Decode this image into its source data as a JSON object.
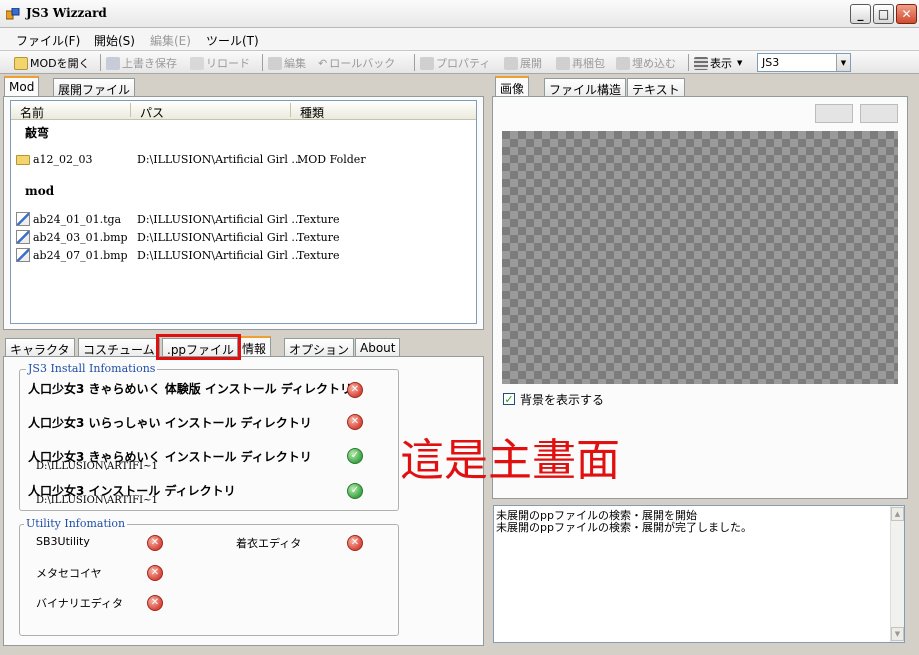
{
  "window": {
    "title": "JS3 Wizzard"
  },
  "menu": {
    "file": "ファイル(F)",
    "start": "開始(S)",
    "edit": "編集(E)",
    "tools": "ツール(T)"
  },
  "toolbar": {
    "open_mod": "MODを開く",
    "overwrite_save": "上書き保存",
    "reload": "リロード",
    "edit": "編集",
    "rollback": "ロールバック",
    "properties": "プロパティ",
    "expand": "展開",
    "repack": "再梱包",
    "embed": "埋め込む",
    "view": "表示",
    "game_select": "JS3"
  },
  "left_tabs": [
    "Mod",
    "展開ファイル"
  ],
  "mod_list": {
    "columns": [
      "名前",
      "パス",
      "種類"
    ],
    "groups": [
      {
        "name": "敲弯",
        "rows": [
          {
            "name": "a12_02_03",
            "path": "D:\\ILLUSION\\Artificial Girl ...",
            "type": "MOD Folder"
          }
        ]
      },
      {
        "name": "mod",
        "rows": [
          {
            "name": "ab24_01_01.tga",
            "path": "D:\\ILLUSION\\Artificial Girl ...",
            "type": "Texture"
          },
          {
            "name": "ab24_03_01.bmp",
            "path": "D:\\ILLUSION\\Artificial Girl ...",
            "type": "Texture"
          },
          {
            "name": "ab24_07_01.bmp",
            "path": "D:\\ILLUSION\\Artificial Girl ...",
            "type": "Texture"
          }
        ]
      }
    ]
  },
  "bottom_tabs": [
    "キャラクタ",
    "コスチューム",
    ".ppファイル",
    "情報",
    "オプション",
    "About"
  ],
  "install_info": {
    "legend": "JS3 Install Infomations",
    "items": [
      {
        "label": "人口少女3 きゃらめいく 体験版 インストール ディレクトリ",
        "path": "",
        "status": "error"
      },
      {
        "label": "人口少女3 いらっしゃい  インストール ディレクトリ",
        "path": "",
        "status": "error"
      },
      {
        "label": "人口少女3 きゃらめいく インストール ディレクトリ",
        "path": "D:\\ILLUSION\\ARTIFI~1",
        "status": "ok"
      },
      {
        "label": "人口少女3 インストール ディレクトリ",
        "path": "D:\\ILLUSION\\ARTIFI~1",
        "status": "ok"
      }
    ]
  },
  "utility_info": {
    "legend": "Utility Infomation",
    "items": [
      {
        "label": "SB3Utility",
        "status": "error"
      },
      {
        "label": "着衣エディタ",
        "status": "error"
      },
      {
        "label": "メタセコイヤ",
        "status": "error"
      },
      {
        "label": "バイナリエディタ",
        "status": "error"
      }
    ]
  },
  "right_tabs": [
    "画像",
    "ファイル構造",
    "テキスト"
  ],
  "show_background": {
    "label": "背景を表示する",
    "checked": true
  },
  "log": [
    "未展開のppファイルの検索・展開を開始",
    "未展開のppファイルの検索・展開が完了しました。"
  ],
  "annotation": {
    "text": "這是主畫面",
    "color": "#e01010"
  }
}
